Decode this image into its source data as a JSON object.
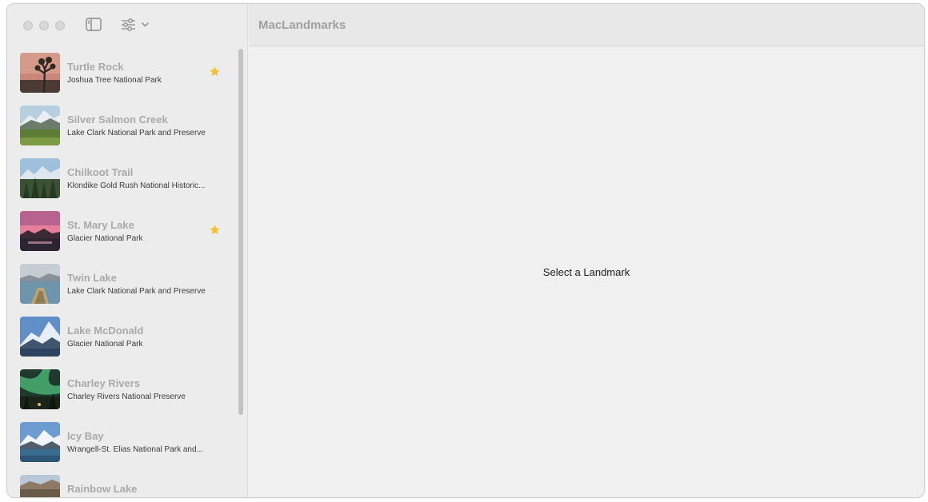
{
  "app": {
    "title": "MacLandmarks"
  },
  "toolbar": {
    "sidebar_toggle_icon": "sidebar-left-icon",
    "filter_icon": "slider-horizontal-icon",
    "filter_chevron": "chevron-down-icon"
  },
  "colors": {
    "favorite_star": "#f5c02a",
    "row_title": "#a9a9a9",
    "placeholder_text": "#1d1d1d"
  },
  "landmarks": [
    {
      "name": "Turtle Rock",
      "park": "Joshua Tree National Park",
      "favorite": true
    },
    {
      "name": "Silver Salmon Creek",
      "park": "Lake Clark National Park and Preserve",
      "favorite": false
    },
    {
      "name": "Chilkoot Trail",
      "park": "Klondike Gold Rush National Historic...",
      "favorite": false
    },
    {
      "name": "St. Mary Lake",
      "park": "Glacier National Park",
      "favorite": true
    },
    {
      "name": "Twin Lake",
      "park": "Lake Clark National Park and Preserve",
      "favorite": false
    },
    {
      "name": "Lake McDonald",
      "park": "Glacier National Park",
      "favorite": false
    },
    {
      "name": "Charley Rivers",
      "park": "Charley Rivers National Preserve",
      "favorite": false
    },
    {
      "name": "Icy Bay",
      "park": "Wrangell-St. Elias National Park and...",
      "favorite": false
    },
    {
      "name": "Rainbow Lake",
      "park": "",
      "favorite": false
    }
  ],
  "detail": {
    "placeholder": "Select a Landmark"
  }
}
